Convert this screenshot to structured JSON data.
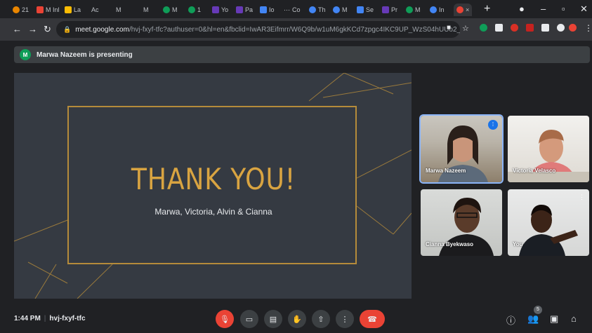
{
  "browser": {
    "tabs": [
      {
        "label": "21",
        "color": "#ea8600"
      },
      {
        "label": "M Inl",
        "color": "#ea4335"
      },
      {
        "label": "La",
        "color": "#fbbc04"
      },
      {
        "label": "Ac",
        "color": "#5f6368"
      },
      {
        "label": "M",
        "color": "#5f6368"
      },
      {
        "label": "M",
        "color": "#5f6368"
      },
      {
        "label": "M",
        "color": "#0f9d58"
      },
      {
        "label": "1",
        "color": "#0f9d58"
      },
      {
        "label": "Yo",
        "color": "#673ab7"
      },
      {
        "label": "Pa",
        "color": "#673ab7"
      },
      {
        "label": "Io",
        "color": "#4285f4"
      },
      {
        "label": "Co",
        "color": "#5f6368"
      },
      {
        "label": "Th",
        "color": "#4285f4"
      },
      {
        "label": "M",
        "color": "#4285f4"
      },
      {
        "label": "Se",
        "color": "#4285f4"
      },
      {
        "label": "Pr",
        "color": "#673ab7"
      },
      {
        "label": "M",
        "color": "#0f9d58"
      },
      {
        "label": "In",
        "color": "#4285f4"
      }
    ],
    "active_tab_close": "×",
    "new_tab": "+",
    "url_host": "meet.google.com",
    "url_path": "/hvj-fxyf-tfc?authuser=0&hl=en&fbclid=IwAR3Eifmrr/W6Q9b/w1uM6gkKCd7zpgc4IKC9UP_WzS04hUUo2_3..."
  },
  "banner": {
    "avatar_initial": "M",
    "text": "Marwa Nazeem is presenting"
  },
  "slide": {
    "title": "THANK YOU!",
    "names": "Marwa, Victoria, Alvin & Cianna",
    "accent": "#d9a441"
  },
  "participants": [
    {
      "name": "Marwa Nazeem"
    },
    {
      "name": "Victoria Velasco"
    },
    {
      "name": "Cianna Byekwaso"
    },
    {
      "name": "You"
    }
  ],
  "footer": {
    "time": "1:44 PM",
    "meeting_code": "hvj-fxyf-tfc",
    "participant_count": "5"
  }
}
